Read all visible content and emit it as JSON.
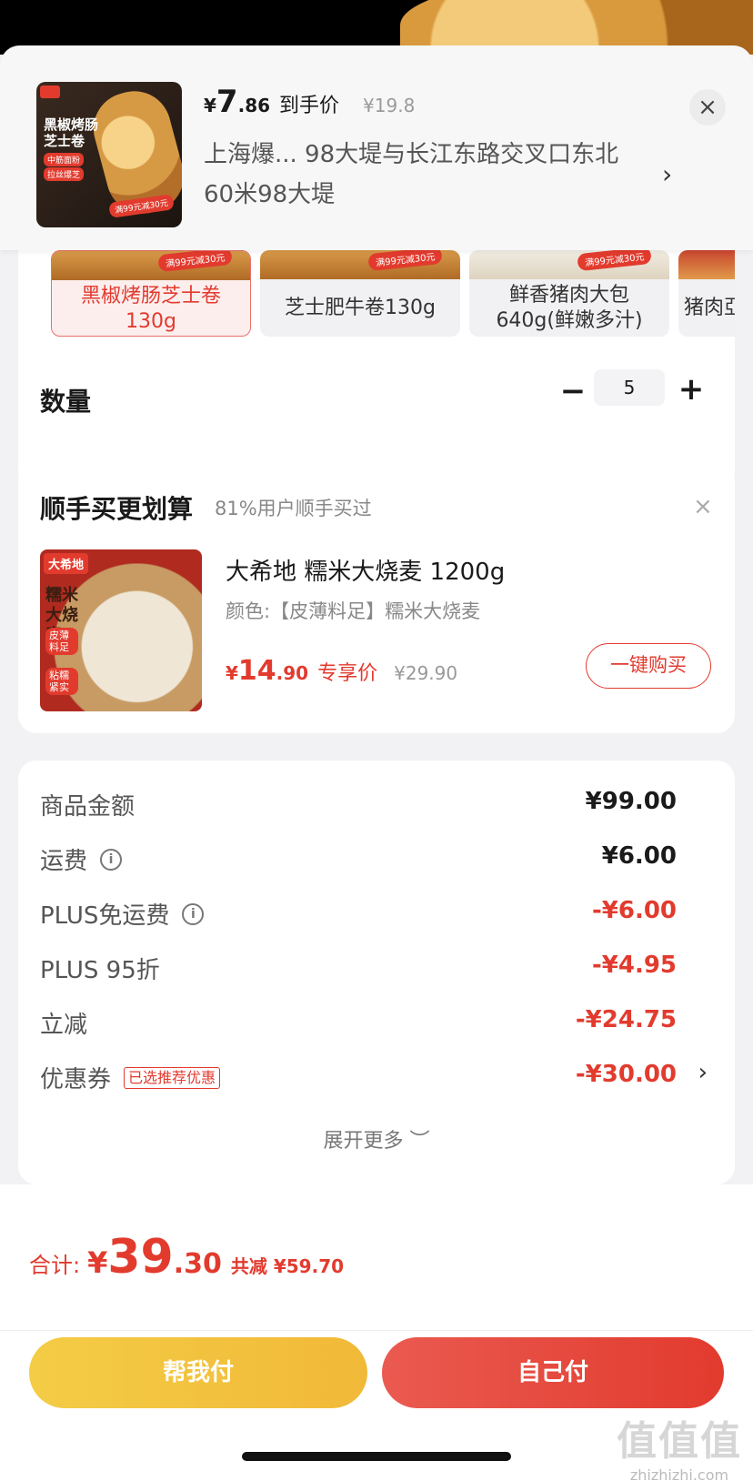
{
  "header": {
    "price_yen": "¥",
    "price_int": "7",
    "price_dec": ".86",
    "price_label": "到手价",
    "original_price": "¥19.8",
    "address": "上海爆... 98大堤与长江东路交叉口东北60米98大堤",
    "thumb_title": "黑椒烤肠芝士卷",
    "thumb_tag1": "中筋面粉",
    "thumb_tag2": "拉丝爆芝",
    "thumb_promo": "满99元减30元",
    "close_icon": "close-icon",
    "chevron_icon": "chevron-right-icon"
  },
  "variants": [
    {
      "label": "黑椒烤肠芝士卷130g",
      "tag": "满99元减30元",
      "selected": true
    },
    {
      "label": "芝士肥牛卷130g",
      "tag": "满99元减30元",
      "selected": false
    },
    {
      "label": "鲜香猪肉大包640g(鲜嫩多汁)",
      "tag": "满99元减30元",
      "selected": false
    },
    {
      "label": "猪肉亞",
      "tag": "",
      "selected": false
    }
  ],
  "quantity": {
    "label": "数量",
    "minus": "−",
    "value": "5",
    "plus": "+"
  },
  "upsell": {
    "title": "顺手买更划算",
    "subtitle": "81%用户顺手买过",
    "close": "×",
    "product_name": "大希地 糯米大烧麦 1200g",
    "spec": "颜色:【皮薄料足】糯米大烧麦",
    "price_yen": "¥",
    "price_int": "14",
    "price_dec": ".90",
    "price_label": "专享价",
    "original_price": "¥29.90",
    "buy_label": "一键购买",
    "thumb_brand": "大希地",
    "thumb_title": "糯米大烧麦",
    "thumb_tag1": "皮薄料足",
    "thumb_tag2": "粘糯紧实"
  },
  "summary": {
    "rows": [
      {
        "label": "商品金额",
        "value": "¥99.00"
      },
      {
        "label": "运费",
        "value": "¥6.00"
      },
      {
        "label": "PLUS免运费",
        "value": "-¥6.00"
      },
      {
        "label": "PLUS 95折",
        "value": "-¥4.95"
      },
      {
        "label": "立减",
        "value": "-¥24.75"
      },
      {
        "label": "优惠券",
        "value": "-¥30.00",
        "tag": "已选推荐优惠"
      }
    ],
    "expand_label": "展开更多 ︶"
  },
  "bottom": {
    "total_label": "合计:",
    "total_yen": "¥",
    "total_int": "39",
    "total_dec": ".30",
    "saved": "共减 ¥59.70",
    "pay_help": "帮我付",
    "pay_self": "自己付"
  },
  "watermark": {
    "main": "值值值",
    "sub": "zhizhizhi.com"
  },
  "colors": {
    "accent": "#e23b2e",
    "yellow": "#f4cc45"
  }
}
